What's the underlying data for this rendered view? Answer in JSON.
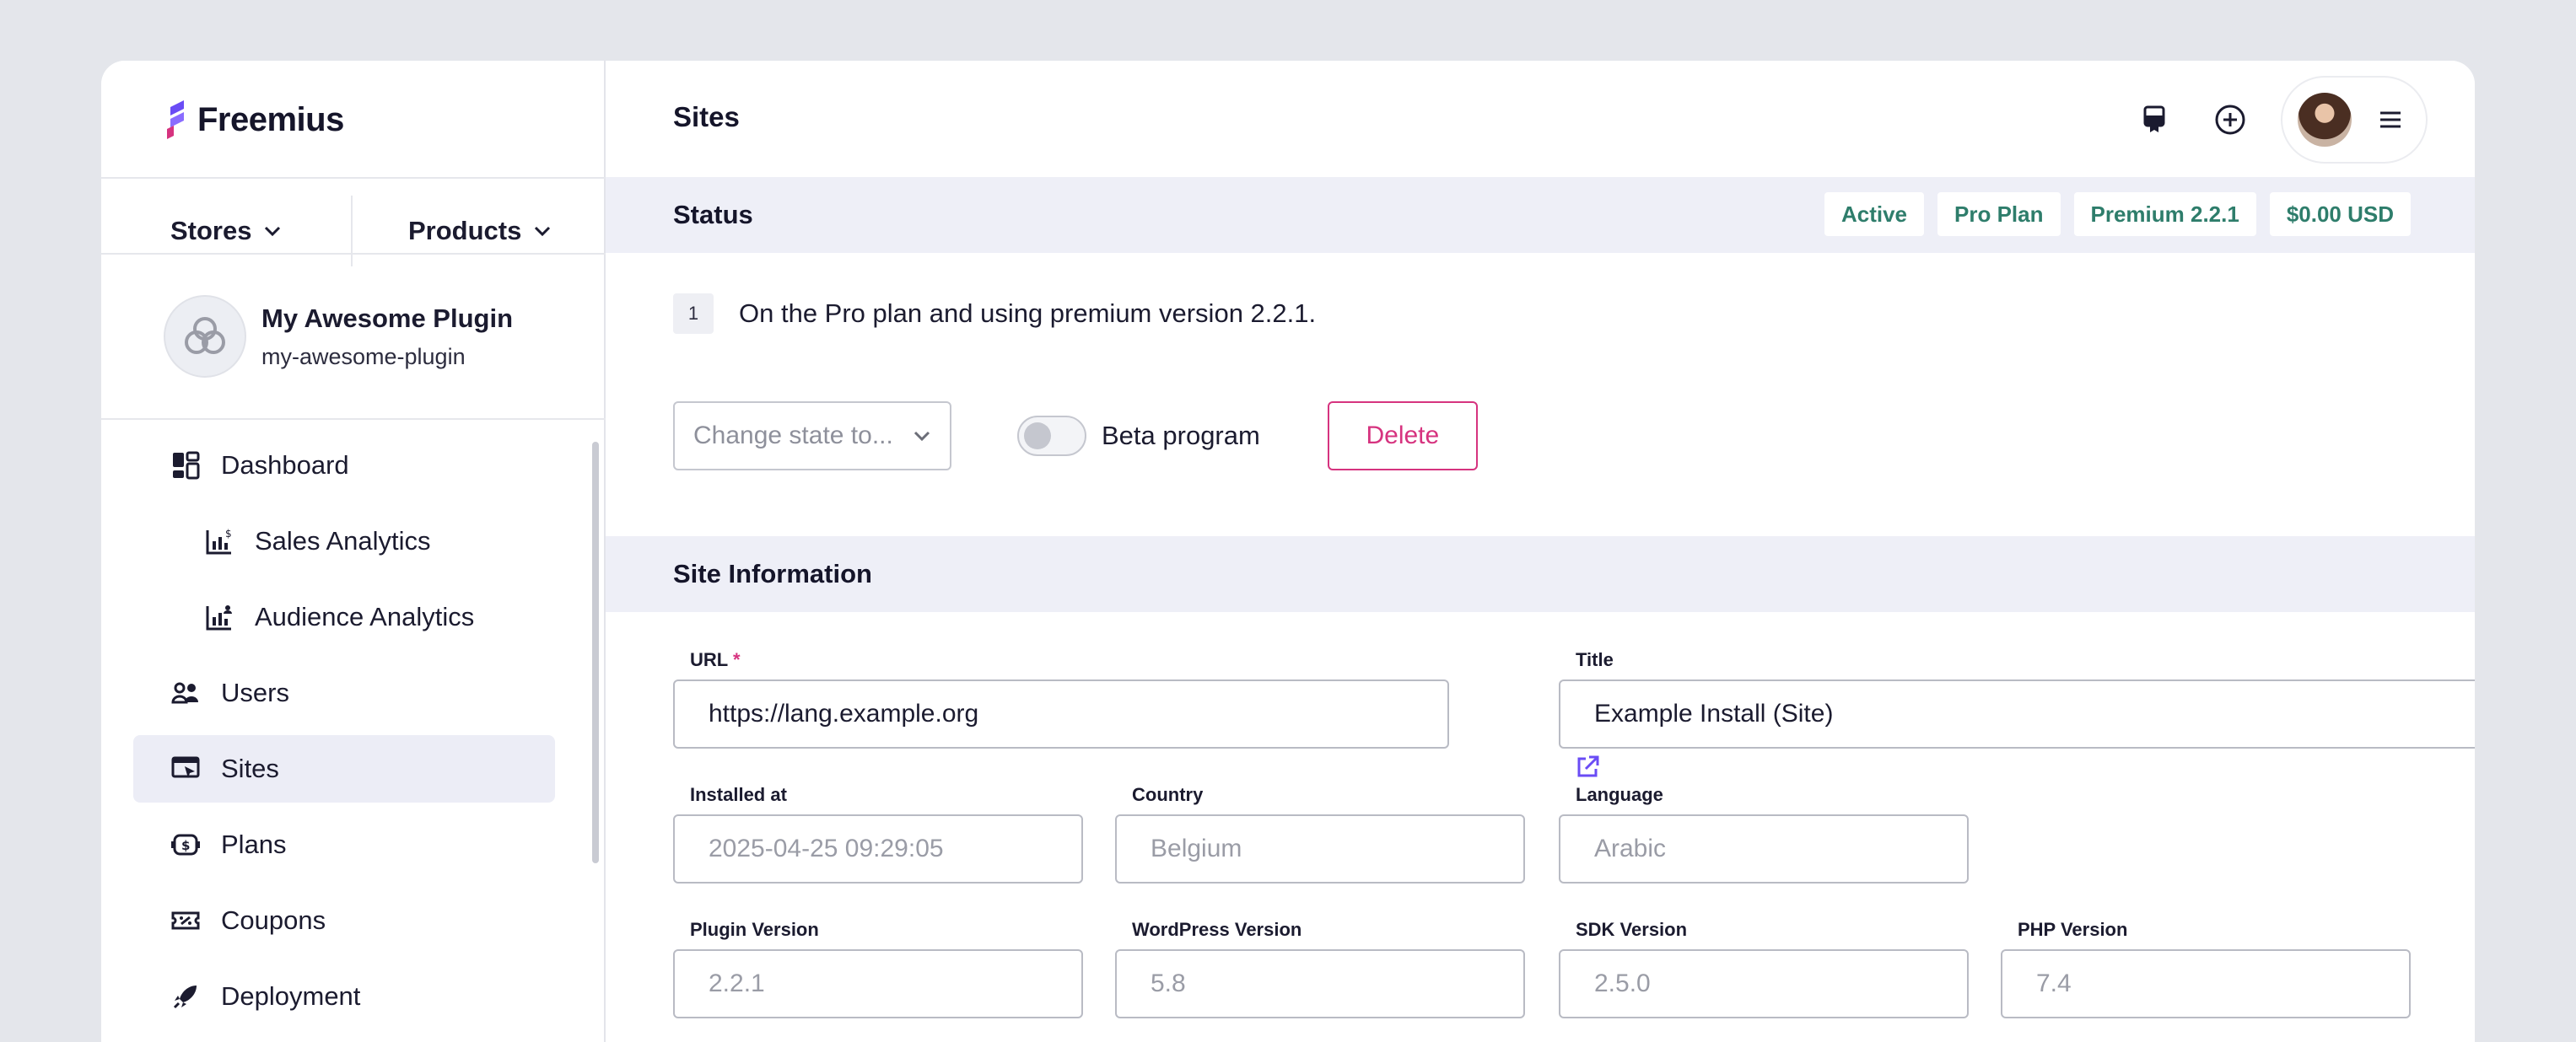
{
  "brand": {
    "name": "Freemius",
    "accent": "#6a4cf5",
    "danger": "#d6337f",
    "success": "#2e7d6b"
  },
  "sidebar": {
    "stores_label": "Stores",
    "products_label": "Products",
    "product": {
      "name": "My Awesome Plugin",
      "slug": "my-awesome-plugin"
    },
    "items": [
      {
        "label": "Dashboard",
        "icon": "dashboard-icon"
      },
      {
        "label": "Sales Analytics",
        "icon": "sales-analytics-icon"
      },
      {
        "label": "Audience Analytics",
        "icon": "audience-analytics-icon"
      },
      {
        "label": "Users",
        "icon": "users-icon"
      },
      {
        "label": "Sites",
        "icon": "sites-icon"
      },
      {
        "label": "Plans",
        "icon": "plans-icon"
      },
      {
        "label": "Coupons",
        "icon": "coupons-icon"
      },
      {
        "label": "Deployment",
        "icon": "deployment-icon"
      }
    ],
    "active_item": "Sites"
  },
  "header": {
    "title": "Sites"
  },
  "status": {
    "heading": "Status",
    "badges": [
      "Active",
      "Pro Plan",
      "Premium 2.2.1",
      "$0.00 USD"
    ],
    "step_number": "1",
    "message": "On the Pro plan and using premium version 2.2.1.",
    "state_placeholder": "Change state to...",
    "beta_label": "Beta program",
    "beta_enabled": false,
    "delete_label": "Delete"
  },
  "site_info": {
    "heading": "Site Information",
    "url": {
      "label": "URL",
      "required_mark": "*",
      "value": "https://lang.example.org"
    },
    "title": {
      "label": "Title",
      "value": "Example Install (Site)"
    },
    "installed_at": {
      "label": "Installed at",
      "value": "2025-04-25 09:29:05"
    },
    "country": {
      "label": "Country",
      "value": "Belgium"
    },
    "language": {
      "label": "Language",
      "value": "Arabic"
    },
    "plugin_version": {
      "label": "Plugin Version",
      "value": "2.2.1"
    },
    "wordpress_version": {
      "label": "WordPress Version",
      "value": "5.8"
    },
    "sdk_version": {
      "label": "SDK Version",
      "value": "2.5.0"
    },
    "php_version": {
      "label": "PHP Version",
      "value": "7.4"
    }
  }
}
